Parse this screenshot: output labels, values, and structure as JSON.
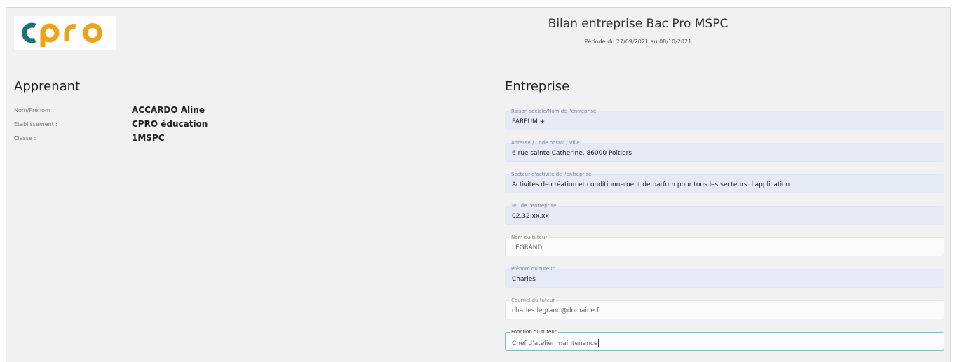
{
  "header": {
    "logo_text": "cpro",
    "title": "Bilan entreprise Bac Pro MSPC",
    "period": "Période du 27/09/2021 au 08/10/2021"
  },
  "apprenant": {
    "section_title": "Apprenant",
    "rows": [
      {
        "label": "Nom/Prénom :",
        "value": "ACCARDO Aline"
      },
      {
        "label": "Etablissement :",
        "value": "CPRO éducation"
      },
      {
        "label": "Classe :",
        "value": "1MSPC"
      }
    ]
  },
  "entreprise": {
    "section_title": "Entreprise",
    "fields": [
      {
        "label": "Raison sociale/Nom de l'entreprise",
        "value": "PARFUM +"
      },
      {
        "label": "Adresse / Code postal / Ville",
        "value": "6 rue sainte Catherine, 86000 Poitiers"
      },
      {
        "label": "Secteur d'activité de l'entreprise",
        "value": "Activités de création et conditionnement de parfum pour tous les secteurs d'application"
      },
      {
        "label": "Tél. de l'entreprise",
        "value": "02.32.xx.xx"
      },
      {
        "label": "Nom du tuteur",
        "value": "LEGRAND"
      },
      {
        "label": "Prénom du tuteur",
        "value": "Charles"
      },
      {
        "label": "Courriel du tuteur",
        "value": "charles.legrand@domaine.fr"
      },
      {
        "label": "Fonction du tuteur",
        "value": "Chef d'atelier maintenance"
      }
    ]
  },
  "colors": {
    "logo_teal": "#1f6f78",
    "logo_orange": "#f0a21a",
    "filled_field_bg": "#e6eaf7",
    "focus_border": "#86b9c2"
  }
}
